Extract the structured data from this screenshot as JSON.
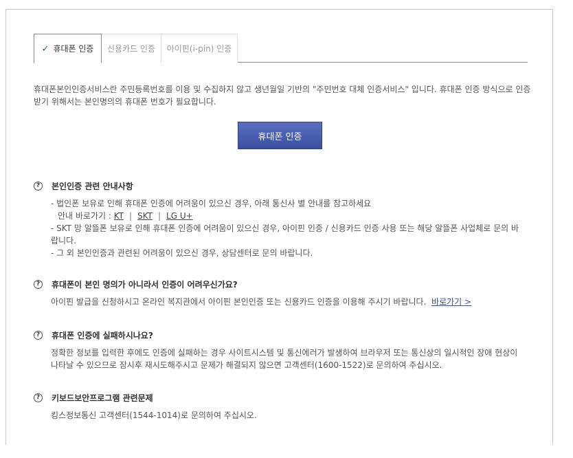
{
  "tabs": [
    {
      "label": "휴대폰 인증",
      "active": true
    },
    {
      "label": "신용카드 인증",
      "active": false
    },
    {
      "label": "아이핀(i-pin) 인증",
      "active": false
    }
  ],
  "intro": "휴대폰본인인증서비스란 주민등록번호를 이용 및 수집하지 않고 생년월일 기반의 \"주민번호 대체 인증서비스\" 입니다. 휴대폰 인증 방식으로 인증 받기 위해서는 본인명의의 휴대폰 번호가 필요합니다.",
  "main_button": "휴대폰 인증",
  "sections": {
    "guide": {
      "title": "본인인증 관련 안내사항",
      "line1": "- 법인폰 보유로 인해 휴대폰 인증에 어려움이 있으신 경우, 아래 통신사 별 안내를 참고하세요",
      "shortcut_label": "안내 바로가기 :",
      "carriers": [
        "KT",
        "SKT",
        "LG U+"
      ],
      "line2": "- SKT 망 알뜰폰 보유로 인해 휴대폰 인증에 어려움이 있으신 경우, 아이핀 인증 / 신용카드 인증 사용 또는 해당 알뜰폰 사업체로 문의 바랍니다.",
      "line3": "- 그 외 본인인증과 관련된 어려움이 있으신 경우, 상담센터로 문의 바랍니다."
    },
    "not_owner": {
      "title": "휴대폰이 본인 명의가 아니라서 인증이 어려우신가요?",
      "body": "아이핀 발급을 신청하시고 온라인 복지관에서 아이핀 본인인증 또는 신용카드 인증을 이용해 주시기 바랍니다.",
      "link": "바로가기 >"
    },
    "failed": {
      "title": "휴대폰 인증에 실패하시나요?",
      "body": "정확한 정보를 입력한 후에도 인증에 실패하는 경우 사이트시스템 및 통신에러가 발생하여 브라우저 또는 통신상의 일시적인 장애 현상이 나타날 수 있으므로 잠시후 재시도해주시고 문제가 해결되지 않으면 고객센터(1600-1522)로 문의하여 주십시오."
    },
    "keyboard": {
      "title": "키보드보안프로그램 관련문제",
      "body": "킹스정보통신 고객센터(1544-1014)로 문의하여 주십시오."
    }
  },
  "question_icon": "?"
}
